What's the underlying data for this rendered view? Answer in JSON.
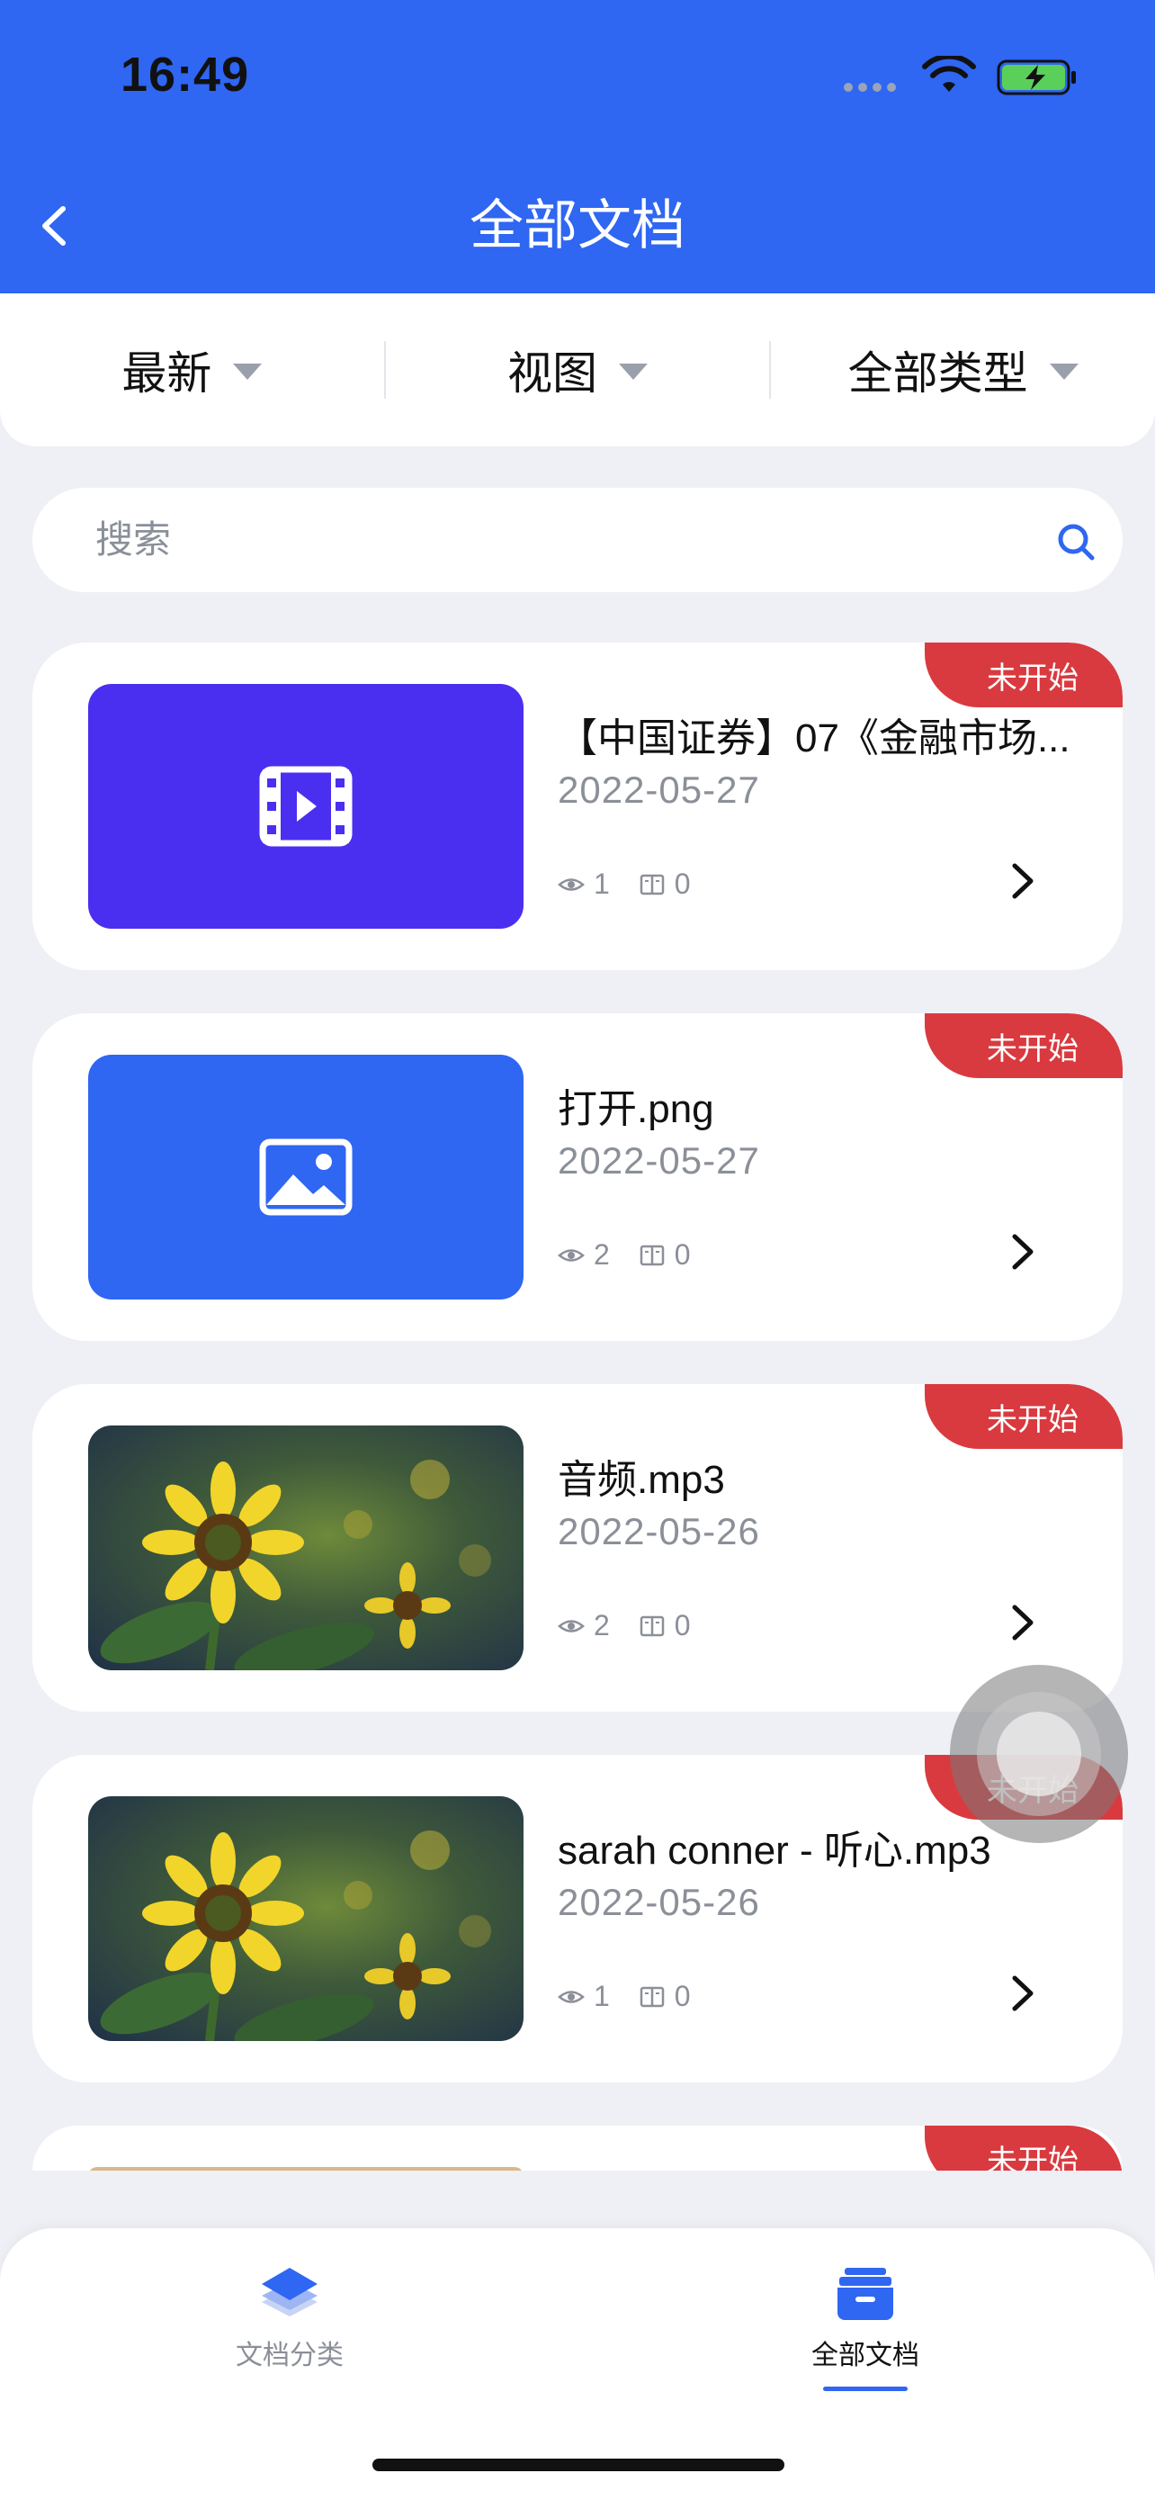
{
  "status_bar": {
    "time": "16:49"
  },
  "header": {
    "title": "全部文档"
  },
  "filters": [
    {
      "label": "最新"
    },
    {
      "label": "视图"
    },
    {
      "label": "全部类型"
    }
  ],
  "search": {
    "placeholder": "搜索",
    "value": ""
  },
  "documents": [
    {
      "badge": "未开始",
      "title": "【中国证券】07《金融市场...",
      "date": "2022-05-27",
      "views": "1",
      "notes": "0",
      "thumb": "video-icon"
    },
    {
      "badge": "未开始",
      "title": "打开.png",
      "date": "2022-05-27",
      "views": "2",
      "notes": "0",
      "thumb": "image-icon"
    },
    {
      "badge": "未开始",
      "title": "音频.mp3",
      "date": "2022-05-26",
      "views": "2",
      "notes": "0",
      "thumb": "sunflower-photo"
    },
    {
      "badge": "未开始",
      "title": "sarah conner - 听心.mp3",
      "date": "2022-05-26",
      "views": "1",
      "notes": "0",
      "thumb": "sunflower-photo"
    },
    {
      "badge": "未开始"
    }
  ],
  "tabbar": {
    "items": [
      {
        "label": "文档分类",
        "icon": "layers-icon",
        "active": false
      },
      {
        "label": "全部文档",
        "icon": "archive-box-icon",
        "active": true
      }
    ]
  },
  "colors": {
    "primary": "#2f66f2",
    "badge": "#d93a3f",
    "video_thumb": "#4a2ff0"
  }
}
